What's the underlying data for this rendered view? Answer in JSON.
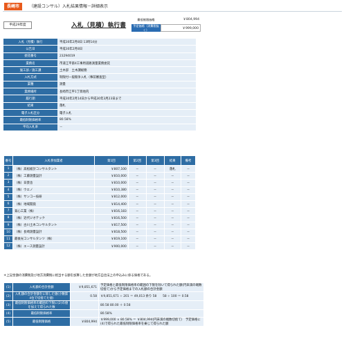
{
  "header": {
    "city": "長崎市",
    "title": "（建設コンサル）入札結果情報－詳細表示"
  },
  "year_badge": "平成29年度",
  "doc_title": "入札（見積）執行書",
  "prices": {
    "min_label": "最低制限価格",
    "min_value": "￥804,994",
    "planned_label": "予定価格（消費税抜く）",
    "planned_value": "￥999,000"
  },
  "info_rows": [
    {
      "k": "入札（見積）執行",
      "v": "平成30年2月8日 13時14分"
    },
    {
      "k": "公告日",
      "v": "平成30年2月8日"
    },
    {
      "k": "委託番号",
      "v": "23294019"
    },
    {
      "k": "業務名",
      "v": "市道江平第4工事用道路測量業務委託"
    },
    {
      "k": "施工部／施工課",
      "v": "土木部　土木課総務"
    },
    {
      "k": "入札方式",
      "v": "制限付一般競争入札（事前審査型）"
    },
    {
      "k": "業種",
      "v": "測量"
    },
    {
      "k": "業務場所",
      "v": "長崎市江平1丁目地内"
    },
    {
      "k": "履行期",
      "v": "平成30年2月14日から平成30年3月23日まで"
    },
    {
      "k": "結果",
      "v": "落札"
    },
    {
      "k": "電子入札区分",
      "v": "電子入札"
    },
    {
      "k": "最低制限価格率",
      "v": "80.58%"
    },
    {
      "k": "平均入札率",
      "v": "－"
    }
  ],
  "bid_headers": [
    "番号",
    "入札参加業者",
    "第1回",
    "第2回",
    "第3回",
    "結果",
    "備考"
  ],
  "bids": [
    {
      "no": "1",
      "name": "（株）高松総計コンサルタント",
      "r1": "￥807,100",
      "r2": "－",
      "r3": "－",
      "res": "落札",
      "rem": "－"
    },
    {
      "no": "2",
      "name": "（株）工藤測量設計",
      "r1": "￥810,000",
      "r2": "－",
      "r3": "－",
      "res": "－",
      "rem": "－"
    },
    {
      "no": "3",
      "name": "（株）日景舎",
      "r1": "￥810,000",
      "r2": "－",
      "r3": "－",
      "res": "－",
      "rem": "－"
    },
    {
      "no": "4",
      "name": "（株）ウエノ",
      "r1": "￥810,380",
      "r2": "－",
      "r3": "－",
      "res": "－",
      "rem": "－"
    },
    {
      "no": "5",
      "name": "（株）サンコー技研",
      "r1": "￥812,000",
      "r2": "－",
      "r3": "－",
      "res": "－",
      "rem": "－"
    },
    {
      "no": "6",
      "name": "（株）地域開発",
      "r1": "￥814,400",
      "r2": "－",
      "r3": "－",
      "res": "－",
      "rem": "－"
    },
    {
      "no": "7",
      "name": "菊心工業（株）",
      "r1": "￥816,183",
      "r2": "－",
      "r3": "－",
      "res": "－",
      "rem": "－"
    },
    {
      "no": "8",
      "name": "（株）近代ジオテック",
      "r1": "￥816,500",
      "r2": "－",
      "r3": "－",
      "res": "－",
      "rem": "－"
    },
    {
      "no": "9",
      "name": "（株）古川土木コンサルタント",
      "r1": "￥817,500",
      "r2": "－",
      "r3": "－",
      "res": "－",
      "rem": "－"
    },
    {
      "no": "10",
      "name": "（株）長崎測量設計",
      "r1": "￥818,500",
      "r2": "－",
      "r3": "－",
      "res": "－",
      "rem": "－"
    },
    {
      "no": "11",
      "name": "最後光コンサルタンツ（株）",
      "r1": "￥819,100",
      "r2": "－",
      "r3": "－",
      "res": "－",
      "rem": "－"
    },
    {
      "no": "12",
      "name": "（株）エース測量設計",
      "r1": "￥900,000",
      "r2": "－",
      "r3": "－",
      "res": "－",
      "rem": "－"
    }
  ],
  "note": "＊上記金額の消費税及び地方消費税に相当する額を加算した金額が地方自治法上の申込みに係る価格である。",
  "calc_rows": [
    {
      "no": "(1)",
      "k": "入札額の合計金額",
      "s": "￥9,851,671",
      "v": "予定価格と最低制限価格率の範囲の下限を除いて得られた額(円未満の端数切捨て)から予定価格までの入札額の合計金額"
    },
    {
      "no": "(2)",
      "k": "入札額の合計金額をに除した値(小数第4位で切捨てた値)",
      "s": "0.58",
      "v": "￥9,851,671 ÷ 201 ＝ 49,013 余り 58　　58 ÷ 100 ＝ 0.58"
    },
    {
      "no": "(3)",
      "k": "最低制限価格率の範囲の下限に(2)の値を加えて得られた数",
      "s": "",
      "v": "80.58 80.00 ＋ 0.58"
    },
    {
      "no": "(4)",
      "k": "最低制限価格率",
      "s": "",
      "v": "80.58%"
    },
    {
      "no": "(5)",
      "k": "最低制限価格",
      "s": "￥804,994",
      "v": "￥999,000 × 80.58% ＝ ￥804,994(円未満の端数切捨て)　予定価格に(4)で得られた最低制限価格率を乗じて得られた額"
    }
  ]
}
